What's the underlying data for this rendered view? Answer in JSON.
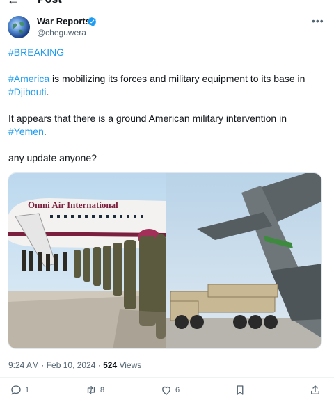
{
  "header": {
    "back_icon": "arrow-left-icon",
    "title": "Post"
  },
  "author": {
    "name": "War Reports",
    "handle": "@cheguwera",
    "verified": true,
    "avatar_icon": "globe-avatar"
  },
  "tweet": {
    "line1": "#BREAKING",
    "p2_tag1": "#America",
    "p2_text": " is mobilizing its forces and military equipment to its base in ",
    "p2_tag2": "#Djibouti",
    "p2_end": ".",
    "p3_text": "It appears that there is a ground American military intervention in ",
    "p3_tag": "#Yemen",
    "p3_end": ".",
    "p4_text": "any update anyone?"
  },
  "media": {
    "left_caption": "Omni Air International"
  },
  "meta": {
    "time": "9:24 AM",
    "dot": " · ",
    "date": "Feb 10, 2024",
    "views_count": "524",
    "views_label": " Views"
  },
  "actions": {
    "replies": "1",
    "reposts": "8",
    "likes": "6"
  },
  "colors": {
    "accent": "#1d9bf0",
    "muted": "#536471",
    "text": "#0f1419"
  }
}
